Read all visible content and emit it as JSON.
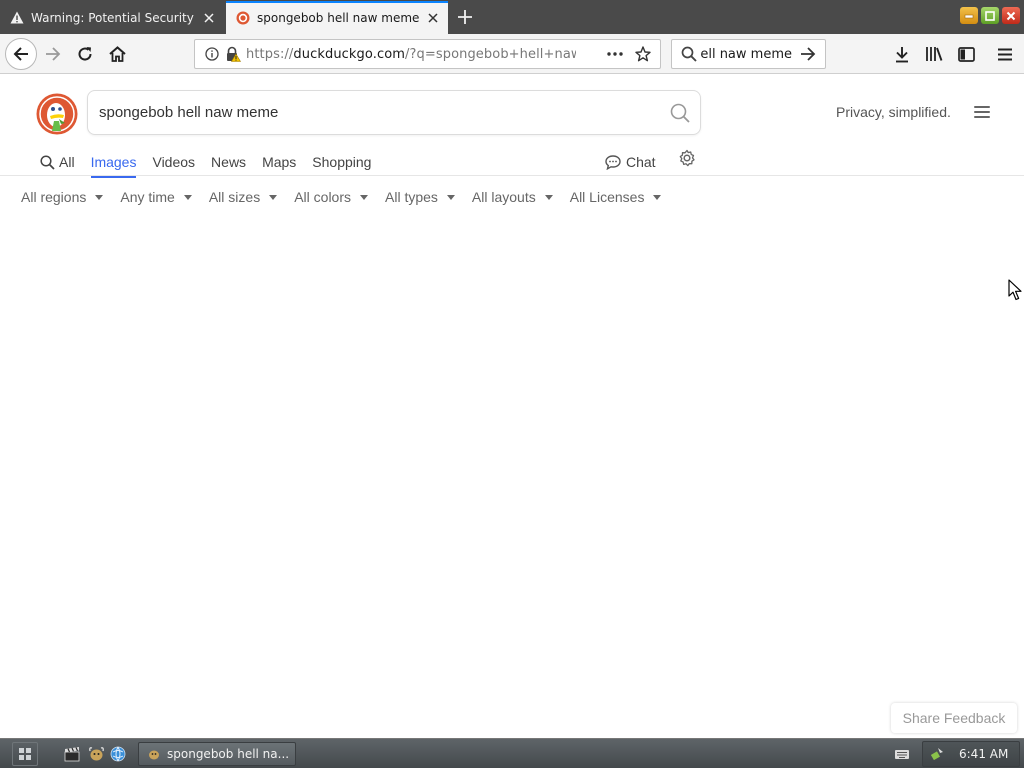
{
  "browser": {
    "tabs": [
      {
        "title": "Warning: Potential Security Risk Ahead",
        "active": false,
        "icon": "warning-icon"
      },
      {
        "title": "spongebob hell naw meme at DuckDuckGo",
        "active": true,
        "icon": "duckduckgo-favicon"
      }
    ],
    "url": {
      "prefix": "https://",
      "host": "duckduckgo.com",
      "path": "/?q=spongebob+hell+naw+meme&iax=images&ia=images"
    },
    "search_box": "spongebob hell naw meme",
    "icons": [
      "back-icon",
      "forward-icon",
      "reload-icon",
      "home-icon",
      "info-icon",
      "lock-warning-icon",
      "more-actions-icon",
      "bookmark-star-icon",
      "search-icon",
      "go-arrow-icon",
      "download-icon",
      "library-icon",
      "sidebar-icon",
      "menu-icon"
    ]
  },
  "ddg": {
    "query": "spongebob hell naw meme",
    "tagline": "Privacy, simplified.",
    "verticals": [
      {
        "label": "All",
        "active": false
      },
      {
        "label": "Images",
        "active": true
      },
      {
        "label": "Videos",
        "active": false
      },
      {
        "label": "News",
        "active": false
      },
      {
        "label": "Maps",
        "active": false
      },
      {
        "label": "Shopping",
        "active": false
      }
    ],
    "chat_label": "Chat",
    "filters": [
      "All regions",
      "Any time",
      "All sizes",
      "All colors",
      "All types",
      "All layouts",
      "All Licenses"
    ],
    "feedback_label": "Share Feedback",
    "accent_color": "#3969ef",
    "logo_color": "#de5833"
  },
  "taskbar": {
    "task_label": "spongebob hell na...",
    "clock": "6:41 AM"
  }
}
